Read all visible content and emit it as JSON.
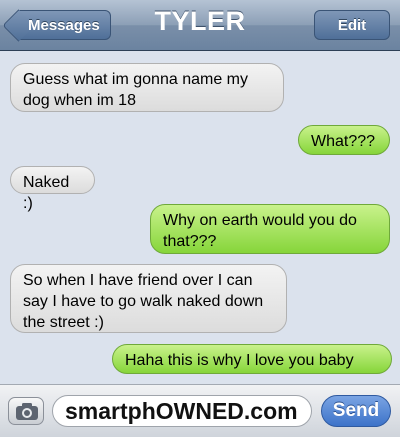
{
  "header": {
    "title": "TYLER",
    "back_label": "Messages",
    "edit_label": "Edit"
  },
  "messages": [
    {
      "from": "them",
      "text": "Guess what im gonna name my dog when im 18"
    },
    {
      "from": "me",
      "text": "What???"
    },
    {
      "from": "them",
      "text": "Naked :)"
    },
    {
      "from": "me",
      "text": "Why on earth would you do that???"
    },
    {
      "from": "them",
      "text": "So when I have friend over I can say I have to go walk naked down the street :)"
    },
    {
      "from": "me",
      "text": "Haha this is why I love you baby"
    }
  ],
  "composer": {
    "input_value": "smartphOWNED.com",
    "send_label": "Send",
    "camera_icon": "camera-icon"
  },
  "colors": {
    "sent_bubble": "#8bd83f",
    "received_bubble": "#e6e6e6",
    "background": "#dbe2ed",
    "send_button": "#3d73c9"
  }
}
